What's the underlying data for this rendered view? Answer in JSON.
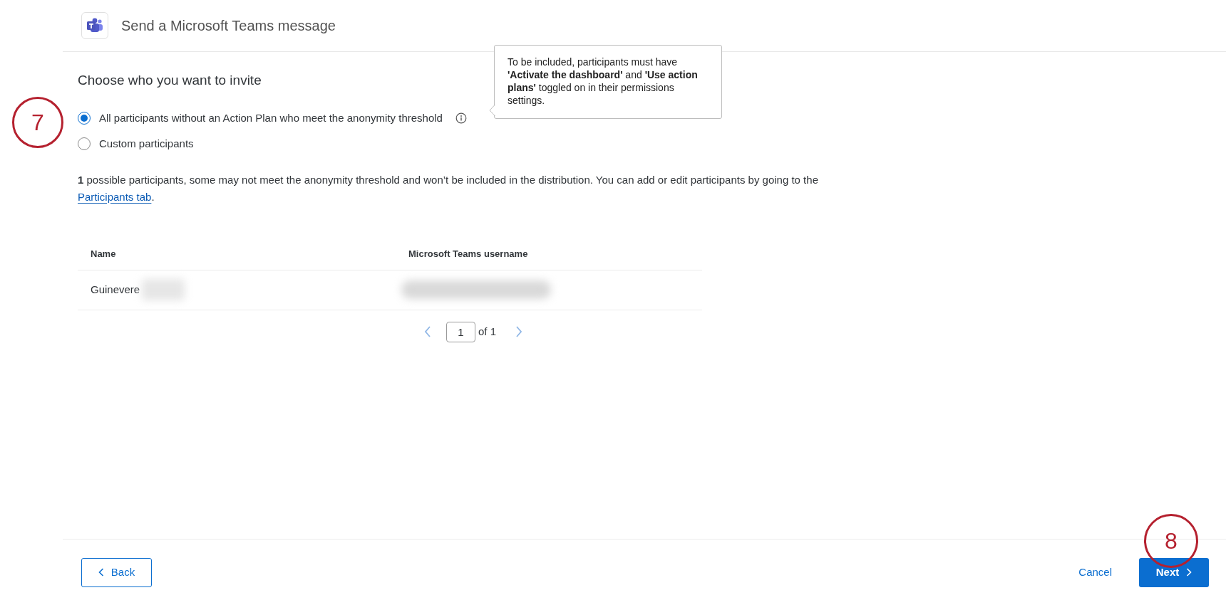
{
  "header": {
    "title": "Send a Microsoft Teams message"
  },
  "section_title": "Choose who you want to invite",
  "options": [
    {
      "label": "All participants without an Action Plan who meet the anonymity threshold",
      "selected": true,
      "info": true
    },
    {
      "label": "Custom participants",
      "selected": false,
      "info": false
    }
  ],
  "tooltip": "To be included, participants must have **'Activate the dashboard'** and **'Use action plans'** toggled on in their permissions settings.",
  "note": {
    "text": "**1** possible participants, some may not meet the anonymity threshold and won’t be included in the distribution. You can add or edit participants by going to the",
    "link": "Participants tab",
    "end": "."
  },
  "table": {
    "columns": [
      "Name",
      "Microsoft Teams username"
    ],
    "rows": [
      {
        "name": "Guinevere"
      }
    ]
  },
  "pagination": {
    "page": "1",
    "of": "of 1"
  },
  "footer": {
    "back": "Back",
    "cancel": "Cancel",
    "next": "Next"
  },
  "annotations": [
    {
      "label": "7"
    },
    {
      "label": "8"
    }
  ]
}
